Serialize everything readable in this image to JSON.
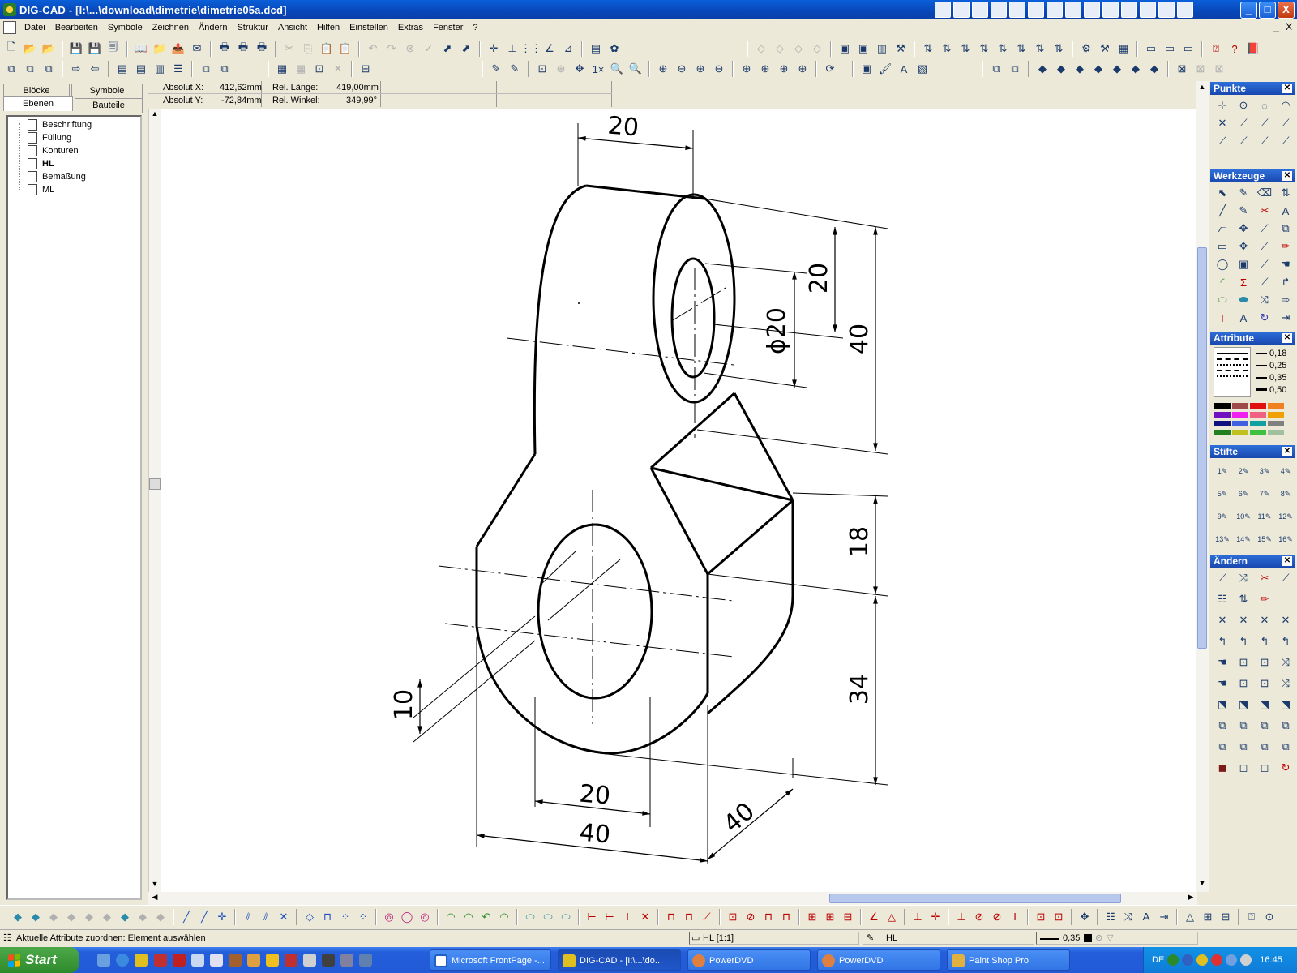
{
  "window": {
    "title": "DIG-CAD - [I:\\...\\download\\dimetrie\\dimetrie05a.dcd]",
    "minimize": "_",
    "maximize": "□",
    "close": "X"
  },
  "menu": {
    "items": [
      "Datei",
      "Bearbeiten",
      "Symbole",
      "Zeichnen",
      "Ändern",
      "Struktur",
      "Ansicht",
      "Hilfen",
      "Einstellen",
      "Extras",
      "Fenster",
      "?"
    ],
    "mdi_minimize": "_",
    "mdi_close": "X"
  },
  "left_panel": {
    "tabs": [
      "Blöcke",
      "Symbole",
      "Ebenen",
      "Bauteile"
    ],
    "active_tab": "Ebenen",
    "layers": [
      "Beschriftung",
      "Füllung",
      "Konturen",
      "HL",
      "Bemaßung",
      "ML"
    ],
    "active_layer": "HL"
  },
  "coordinates": {
    "abs_x_label": "Absolut X:",
    "abs_x_value": "412,62mm",
    "abs_y_label": "Absolut Y:",
    "abs_y_value": "-72,84mm",
    "rel_len_label": "Rel. Länge:",
    "rel_len_value": "419,00mm",
    "rel_angle_label": "Rel. Winkel:",
    "rel_angle_value": "349,99°"
  },
  "drawing": {
    "dims": {
      "top_width": "20",
      "hole_offset": "20",
      "hole_diameter": "ϕ20",
      "upper_height": "40",
      "mid_height": "18",
      "lower_height": "34",
      "slot_offset": "10",
      "slot_width": "20",
      "base_width": "40",
      "depth": "40"
    }
  },
  "panels": {
    "punkte": "Punkte",
    "werkzeuge": "Werkzeuge",
    "attribute": "Attribute",
    "stifte": "Stifte",
    "aendern": "Ändern",
    "line_widths": [
      "0,18",
      "0,25",
      "0,35",
      "0,50"
    ],
    "colors": [
      "#000000",
      "#9c4a4a",
      "#e01010",
      "#f08020",
      "#7010c0",
      "#f020f0",
      "#f06080",
      "#f0a000",
      "#101080",
      "#4060e0",
      "#10a0a0",
      "#808080",
      "#208020",
      "#c0c020",
      "#40c040",
      "#a0c0a0"
    ],
    "pens": [
      "1",
      "2",
      "3",
      "4",
      "5",
      "6",
      "7",
      "8",
      "9",
      "10",
      "11",
      "12",
      "13",
      "14",
      "15",
      "16"
    ]
  },
  "status": {
    "message": "Aktuelle Attribute zuordnen: Element auswählen",
    "layer": "HL [1:1]",
    "pen_layer": "HL",
    "line_width": "0,35"
  },
  "taskbar": {
    "start": "Start",
    "tasks": [
      "Microsoft FrontPage -...",
      "DIG-CAD - [I:\\...\\do...",
      "PowerDVD",
      "PowerDVD",
      "Paint Shop Pro"
    ],
    "language": "DE",
    "time": "16:45"
  }
}
